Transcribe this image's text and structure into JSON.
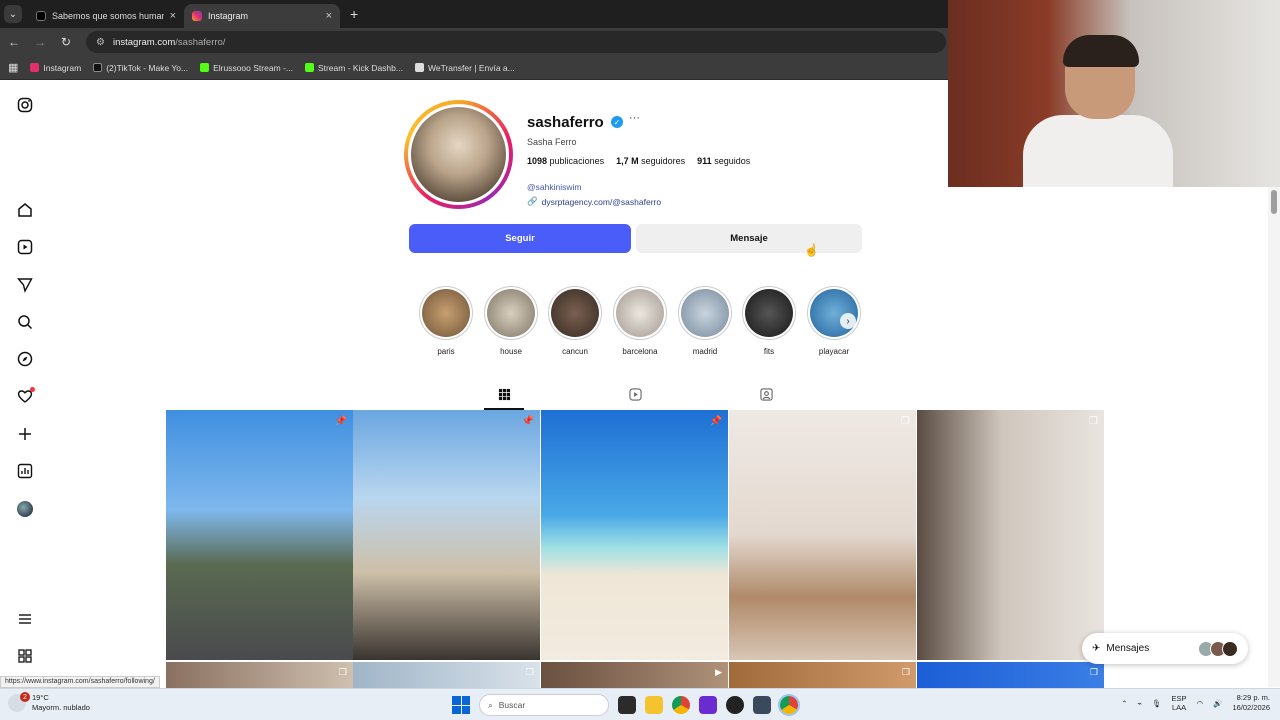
{
  "browser": {
    "tabs": [
      {
        "label": "Sabemos que somos humanos",
        "close": "×",
        "icon_color": "#000000"
      },
      {
        "label": "Instagram",
        "close": "×",
        "icon_color": "#e1306c"
      }
    ],
    "new_tab": "+",
    "url": "instagram.com",
    "url_path": "/sashaferro/",
    "bookmarks": [
      {
        "label": "Instagram",
        "color": "#e1306c"
      },
      {
        "label": "(2)TikTok - Make Yo...",
        "color": "#111111"
      },
      {
        "label": "Elrussooo Stream -...",
        "color": "#53fc18"
      },
      {
        "label": "Stream - Kick Dashb...",
        "color": "#53fc18"
      },
      {
        "label": "WeTransfer | Envía a...",
        "color": "#dddddd"
      }
    ]
  },
  "profile": {
    "username": "sashaferro",
    "verified_icon": "✓",
    "more": "···",
    "full_name": "Sasha Ferro",
    "posts_count": "1098",
    "posts_label": "publicaciones",
    "followers_count": "1,7 M",
    "followers_label": "seguidores",
    "following_count": "911",
    "following_label": "seguidos",
    "mention": "@sahkiniswim",
    "link": "dysrptagency.com/@sashaferro",
    "follow_button": "Seguir",
    "message_button": "Mensaje"
  },
  "highlights": [
    {
      "label": "paris",
      "color": "#8a6b4a"
    },
    {
      "label": "house",
      "color": "#9a9080"
    },
    {
      "label": "cancun",
      "color": "#4a3a30"
    },
    {
      "label": "barcelona",
      "color": "#b8b0a8"
    },
    {
      "label": "madrid",
      "color": "#8fa0b0"
    },
    {
      "label": "fits",
      "color": "#2a2a2a"
    },
    {
      "label": "playacar",
      "color": "#3a7ab0"
    }
  ],
  "messages_widget": {
    "label": "Mensajes"
  },
  "status_url": "https://www.instagram.com/sashaferro/following/",
  "taskbar": {
    "temperature": "19°C",
    "weather": "Mayorm. nublado",
    "notification_count": "2",
    "search_placeholder": "Buscar",
    "lang_top": "ESP",
    "lang_bottom": "LAA",
    "time": "8:29 p. m.",
    "date": "16/02/2026"
  }
}
